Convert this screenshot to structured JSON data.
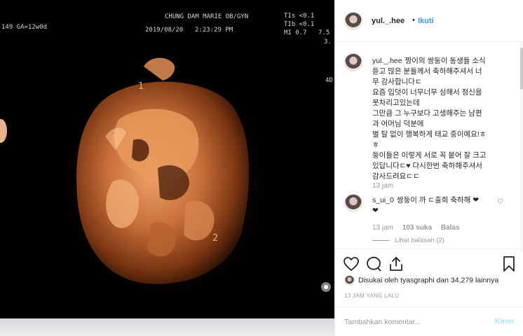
{
  "photo": {
    "scan": {
      "clinic": "CHUNG DAM MARIE OB/GYN",
      "left_info": "149  GA=12w0d",
      "date": "2019/08/20",
      "time": "2:23:29 PM",
      "tis": "TIs <0.1",
      "tib": "TIb <0.1",
      "mi": "MI   0.7",
      "edge_right": "7.5",
      "edge_right2": "3.",
      "mode": "4D",
      "marker1": "1",
      "marker2": "2"
    }
  },
  "header": {
    "username": "yul._.hee",
    "dot": "•",
    "follow_label": "Ikuti"
  },
  "caption": {
    "username": "yul._.hee",
    "lines": [
      "짱이의 쌍둥이 동생들 소식",
      "듣고 많은 분들께서 축하해주셔서 너",
      "무 감사합니다ㄷ",
      "요즘 입덧이 너무너무 심해서 정신을",
      "못차리고있는데",
      "그만큼 그 누구보다 고생해주는 남편",
      "과 어머님 덕분에",
      "별 탈 없이 행복하게 태교 중이예요!ㅎ",
      "ㅎ",
      "둥이들은 이렇게 서로 꼭 붙어 잘 크고",
      "있답니다ㄷ♥ 다시한번 축하해주셔서",
      "감사드려요ㄷㄷ"
    ],
    "time": "13 jam"
  },
  "comment": {
    "username": "s_ui_0",
    "text": "쌍둥이 까 ㄷ출희 축하해 ❤",
    "text2": "❤",
    "time": "13 jam",
    "likes": "103 suka",
    "reply": "Balas",
    "view_replies": "Lihat balasan (2)"
  },
  "footer": {
    "liked_by": "Disukai oleh tyasgraphi dan 34,279 lainnya",
    "date": "13 JAM YANG LALU",
    "comment_placeholder": "Tambahkan komentar...",
    "post_label": "Kirim"
  }
}
